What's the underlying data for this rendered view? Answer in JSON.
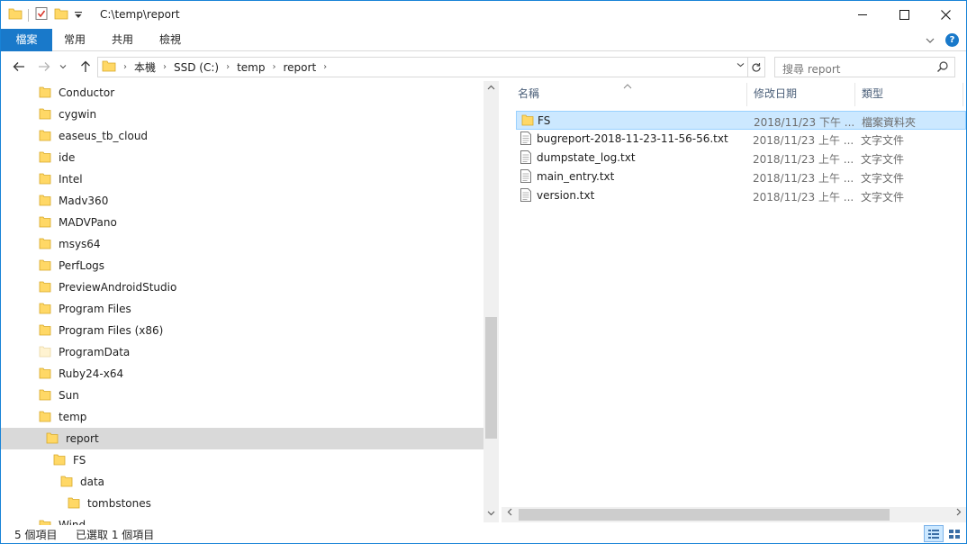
{
  "window": {
    "title": "C:\\temp\\report",
    "controls": {
      "minimize": "—",
      "maximize": "☐",
      "close": "✕"
    }
  },
  "ribbon": {
    "tabs": [
      {
        "label": "檔案"
      },
      {
        "label": "常用"
      },
      {
        "label": "共用"
      },
      {
        "label": "檢視"
      }
    ],
    "expand_icon": "chevron-down-icon",
    "help": "?"
  },
  "address": {
    "crumbs": [
      "本機",
      "SSD (C:)",
      "temp",
      "report"
    ]
  },
  "search": {
    "placeholder": "搜尋 report"
  },
  "tree": [
    {
      "label": "Conductor",
      "level": 0
    },
    {
      "label": "cygwin",
      "level": 0
    },
    {
      "label": "easeus_tb_cloud",
      "level": 0
    },
    {
      "label": "ide",
      "level": 0
    },
    {
      "label": "Intel",
      "level": 0
    },
    {
      "label": "Madv360",
      "level": 0
    },
    {
      "label": "MADVPano",
      "level": 0
    },
    {
      "label": "msys64",
      "level": 0
    },
    {
      "label": "PerfLogs",
      "level": 0
    },
    {
      "label": "PreviewAndroidStudio",
      "level": 0
    },
    {
      "label": "Program Files",
      "level": 0
    },
    {
      "label": "Program Files (x86)",
      "level": 0
    },
    {
      "label": "ProgramData",
      "level": 0,
      "faded": true
    },
    {
      "label": "Ruby24-x64",
      "level": 0
    },
    {
      "label": "Sun",
      "level": 0
    },
    {
      "label": "temp",
      "level": 0
    },
    {
      "label": "report",
      "level": 1,
      "selected": true
    },
    {
      "label": "FS",
      "level": 2
    },
    {
      "label": "data",
      "level": 3
    },
    {
      "label": "tombstones",
      "level": 4
    },
    {
      "label": "Wind",
      "level": 0,
      "partial": true
    }
  ],
  "columns": {
    "name": "名稱",
    "date": "修改日期",
    "type": "類型"
  },
  "files": [
    {
      "name": "FS",
      "date": "2018/11/23 下午 ...",
      "type": "檔案資料夾",
      "icon": "folder-icon",
      "selected": true
    },
    {
      "name": "bugreport-2018-11-23-11-56-56.txt",
      "date": "2018/11/23 上午 ...",
      "type": "文字文件",
      "icon": "text-file-icon"
    },
    {
      "name": "dumpstate_log.txt",
      "date": "2018/11/23 上午 ...",
      "type": "文字文件",
      "icon": "text-file-icon"
    },
    {
      "name": "main_entry.txt",
      "date": "2018/11/23 上午 ...",
      "type": "文字文件",
      "icon": "text-file-icon"
    },
    {
      "name": "version.txt",
      "date": "2018/11/23 上午 ...",
      "type": "文字文件",
      "icon": "text-file-icon"
    }
  ],
  "status": {
    "item_count": "5 個項目",
    "selected_count": "已選取 1 個項目"
  },
  "colors": {
    "accent": "#1979ca",
    "selection": "#cce8ff",
    "selection_border": "#99d1ff",
    "folder": "#ffd866",
    "tree_selected": "#d9d9d9"
  }
}
